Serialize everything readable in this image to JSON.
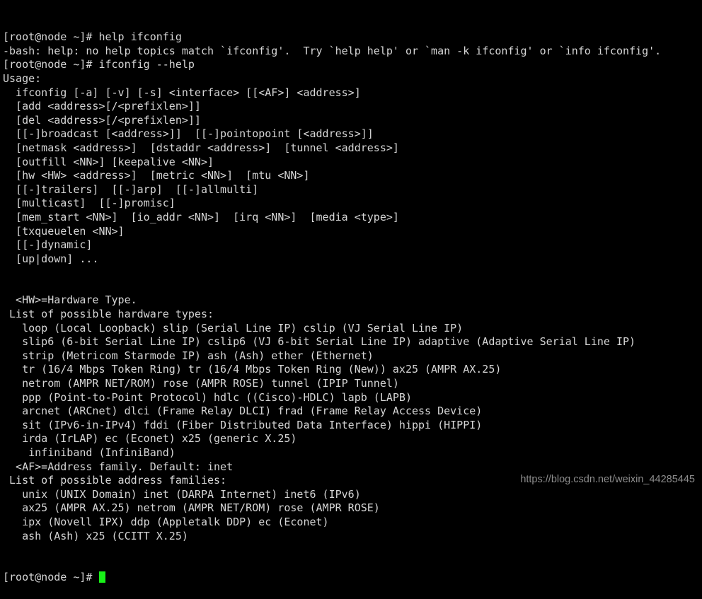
{
  "window": {
    "title": "root@node:~",
    "background_color": "#000000",
    "foreground_color": "#d6d6d6",
    "cursor_color": "#18f218"
  },
  "terminal": {
    "prompt": "[root@node ~]# ",
    "lines": [
      "[root@node ~]# help ifconfig",
      "-bash: help: no help topics match `ifconfig'.  Try `help help' or `man -k ifconfig' or `info ifconfig'.",
      "[root@node ~]# ifconfig --help",
      "Usage:",
      "  ifconfig [-a] [-v] [-s] <interface> [[<AF>] <address>]",
      "  [add <address>[/<prefixlen>]]",
      "  [del <address>[/<prefixlen>]]",
      "  [[-]broadcast [<address>]]  [[-]pointopoint [<address>]]",
      "  [netmask <address>]  [dstaddr <address>]  [tunnel <address>]",
      "  [outfill <NN>] [keepalive <NN>]",
      "  [hw <HW> <address>]  [metric <NN>]  [mtu <NN>]",
      "  [[-]trailers]  [[-]arp]  [[-]allmulti]",
      "  [multicast]  [[-]promisc]",
      "  [mem_start <NN>]  [io_addr <NN>]  [irq <NN>]  [media <type>]",
      "  [txqueuelen <NN>]",
      "  [[-]dynamic]",
      "  [up|down] ...",
      "",
      "",
      "  <HW>=Hardware Type.",
      " List of possible hardware types:",
      "   loop (Local Loopback) slip (Serial Line IP) cslip (VJ Serial Line IP)",
      "   slip6 (6-bit Serial Line IP) cslip6 (VJ 6-bit Serial Line IP) adaptive (Adaptive Serial Line IP)",
      "   strip (Metricom Starmode IP) ash (Ash) ether (Ethernet)",
      "   tr (16/4 Mbps Token Ring) tr (16/4 Mbps Token Ring (New)) ax25 (AMPR AX.25)",
      "   netrom (AMPR NET/ROM) rose (AMPR ROSE) tunnel (IPIP Tunnel)",
      "   ppp (Point-to-Point Protocol) hdlc ((Cisco)-HDLC) lapb (LAPB)",
      "   arcnet (ARCnet) dlci (Frame Relay DLCI) frad (Frame Relay Access Device)",
      "   sit (IPv6-in-IPv4) fddi (Fiber Distributed Data Interface) hippi (HIPPI)",
      "   irda (IrLAP) ec (Econet) x25 (generic X.25)",
      "    infiniband (InfiniBand)",
      "  <AF>=Address family. Default: inet",
      " List of possible address families:",
      "   unix (UNIX Domain) inet (DARPA Internet) inet6 (IPv6)",
      "   ax25 (AMPR AX.25) netrom (AMPR NET/ROM) rose (AMPR ROSE)",
      "   ipx (Novell IPX) ddp (Appletalk DDP) ec (Econet)",
      "   ash (Ash) x25 (CCITT X.25)"
    ],
    "final_prompt": "[root@node ~]# "
  },
  "watermark": {
    "text": "https://blog.csdn.net/weixin_44285445",
    "color": "#8d8d8d"
  }
}
